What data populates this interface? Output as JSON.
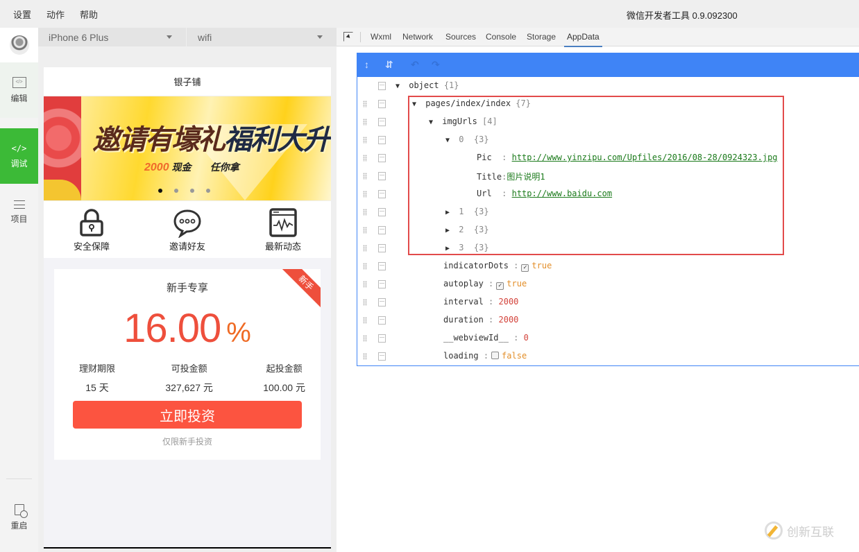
{
  "menubar": {
    "items": [
      "设置",
      "动作",
      "帮助"
    ],
    "app_title": "微信开发者工具 0.9.092300"
  },
  "activity_bar": {
    "items": [
      {
        "id": "edit",
        "label": "编辑",
        "icon": "code-window-icon"
      },
      {
        "id": "debug",
        "label": "调试",
        "icon": "code-brackets-icon",
        "active": true
      },
      {
        "id": "project",
        "label": "项目",
        "icon": "menu-lines-icon"
      },
      {
        "id": "restart",
        "label": "重启",
        "icon": "restart-icon"
      }
    ],
    "active_color": "#3cba37"
  },
  "device_bar": {
    "device": "iPhone 6 Plus",
    "network": "wifi"
  },
  "simulator": {
    "nav_title": "银子铺",
    "banner": {
      "headline_part1": "邀请有壕礼",
      "headline_part2": "福利大升",
      "sub_amount": "2000",
      "sub_cash": "现金",
      "sub_tail": "任你拿",
      "dot_count": 4,
      "active_dot": 0
    },
    "quick_links": [
      {
        "label": "安全保障",
        "icon": "lock-icon"
      },
      {
        "label": "邀请好友",
        "icon": "chat-bubble-icon"
      },
      {
        "label": "最新动态",
        "icon": "activity-monitor-icon"
      }
    ],
    "product_card": {
      "ribbon": "新手",
      "title": "新手专享",
      "rate": "16.00",
      "rate_unit": "%",
      "stats": [
        {
          "label": "理财期限",
          "value": "15 天"
        },
        {
          "label": "可投金额",
          "value": "327,627 元"
        },
        {
          "label": "起投金额",
          "value": "100.00 元"
        }
      ],
      "button": "立即投资",
      "note": "仅限新手投资",
      "accent": "#fc5440"
    }
  },
  "devtools": {
    "tabs": [
      "Wxml",
      "Network",
      "Sources",
      "Console",
      "Storage",
      "AppData"
    ],
    "active_tab": "AppData",
    "toolbar_color": "#3f84f6",
    "tree": {
      "root": {
        "key": "object",
        "count": "{1}"
      },
      "page": {
        "key": "pages/index/index",
        "count": "{7}"
      },
      "imgUrls": {
        "key": "imgUrls",
        "count": "[4]"
      },
      "item0": {
        "key": "0",
        "count": "{3}"
      },
      "pic": {
        "key": "Pic",
        "value": "http://www.yinzipu.com/Upfiles/2016/08-28/0924323.jpg"
      },
      "title": {
        "key": "Title",
        "value": "图片说明1"
      },
      "url": {
        "key": "Url",
        "value": "http://www.baidu.com"
      },
      "item1": {
        "key": "1",
        "count": "{3}"
      },
      "item2": {
        "key": "2",
        "count": "{3}"
      },
      "item3": {
        "key": "3",
        "count": "{3}"
      },
      "indicatorDots": {
        "key": "indicatorDots",
        "value": "true",
        "checked": true
      },
      "autoplay": {
        "key": "autoplay",
        "value": "true",
        "checked": true
      },
      "interval": {
        "key": "interval",
        "value": "2000"
      },
      "duration": {
        "key": "duration",
        "value": "2000"
      },
      "webviewId": {
        "key": "__webviewId__",
        "value": "0"
      },
      "loading": {
        "key": "loading",
        "value": "false",
        "checked": false
      }
    }
  },
  "watermark": {
    "text": "创新互联"
  }
}
